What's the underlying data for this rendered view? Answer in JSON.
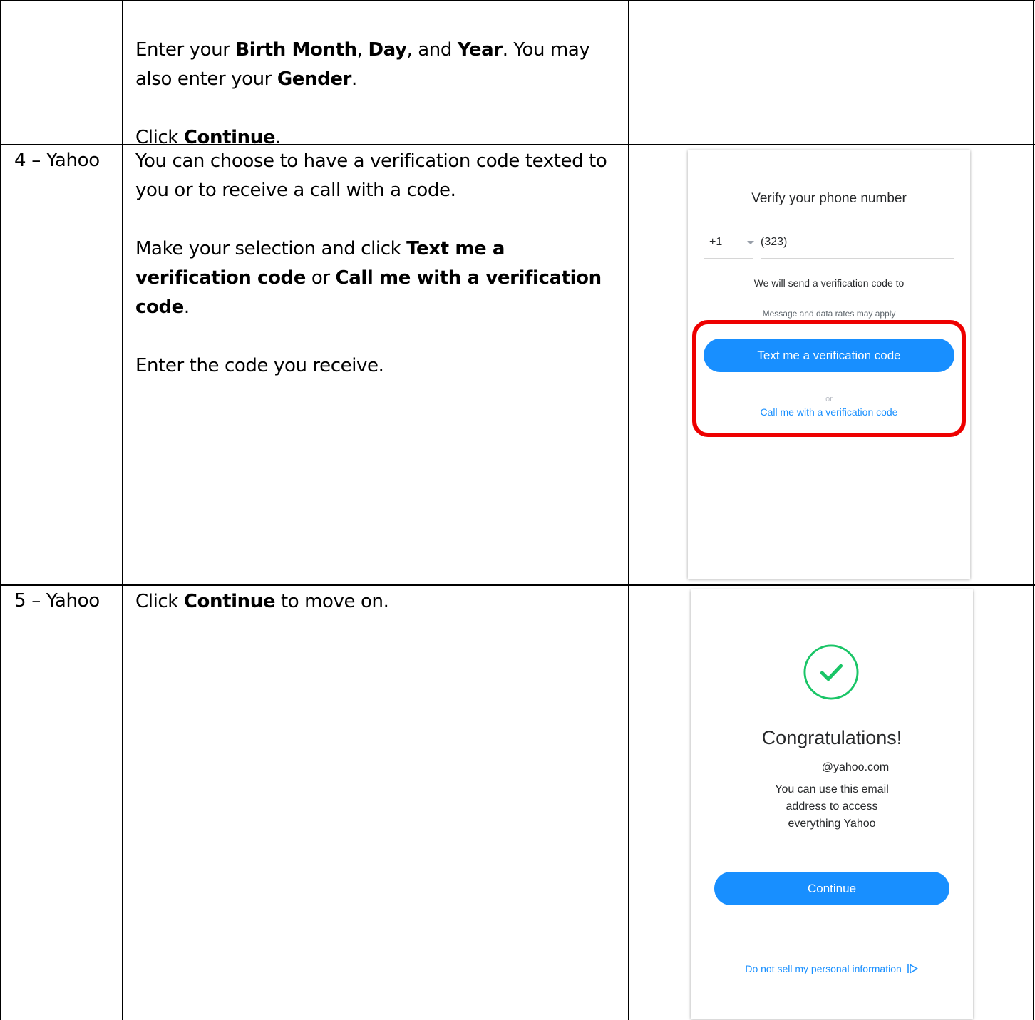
{
  "rows": [
    {
      "label": "",
      "paragraphs": [
        [
          {
            "t": "Enter your "
          },
          {
            "t": "Birth Month",
            "b": true
          },
          {
            "t": ", "
          },
          {
            "t": "Day",
            "b": true
          },
          {
            "t": ", and "
          },
          {
            "t": "Year",
            "b": true
          },
          {
            "t": ". You may also enter your "
          },
          {
            "t": "Gender",
            "b": true
          },
          {
            "t": "."
          }
        ],
        [
          {
            "t": "Click "
          },
          {
            "t": "Continue",
            "b": true
          },
          {
            "t": "."
          }
        ]
      ]
    },
    {
      "label": "4 – Yahoo",
      "paragraphs": [
        [
          {
            "t": "You can choose to have a verification code texted to you or to receive a call with a code."
          }
        ],
        [
          {
            "t": "Make your selection and click "
          },
          {
            "t": "Text me a verification code",
            "b": true
          },
          {
            "t": " or "
          },
          {
            "t": "Call me with a verification code",
            "b": true
          },
          {
            "t": "."
          }
        ],
        [
          {
            "t": "Enter the code you receive."
          }
        ]
      ]
    },
    {
      "label": "5 – Yahoo",
      "paragraphs": [
        [
          {
            "t": "Click "
          },
          {
            "t": "Continue",
            "b": true
          },
          {
            "t": " to move on."
          }
        ]
      ]
    }
  ],
  "verify_screen": {
    "title": "Verify your phone number",
    "country_code": "+1",
    "phone_number": "(323)",
    "send_note": "We will send a verification code to",
    "rates_note": "Message and data rates may apply",
    "text_button": "Text me a verification code",
    "or_text": "or",
    "call_link": "Call me with a verification code",
    "highlight_color": "#ee0000"
  },
  "success_screen": {
    "check_icon": "check-circle-icon",
    "heading": "Congratulations!",
    "email": "@yahoo.com",
    "message_lines": [
      "You can use this email",
      "address to access",
      "everything Yahoo"
    ],
    "continue_button": "Continue",
    "privacy_link": "Do not sell my personal information",
    "privacy_icon": "play-outline-icon"
  },
  "colors": {
    "accent": "#188fff",
    "success": "#1ac567",
    "text": "#26282a"
  }
}
